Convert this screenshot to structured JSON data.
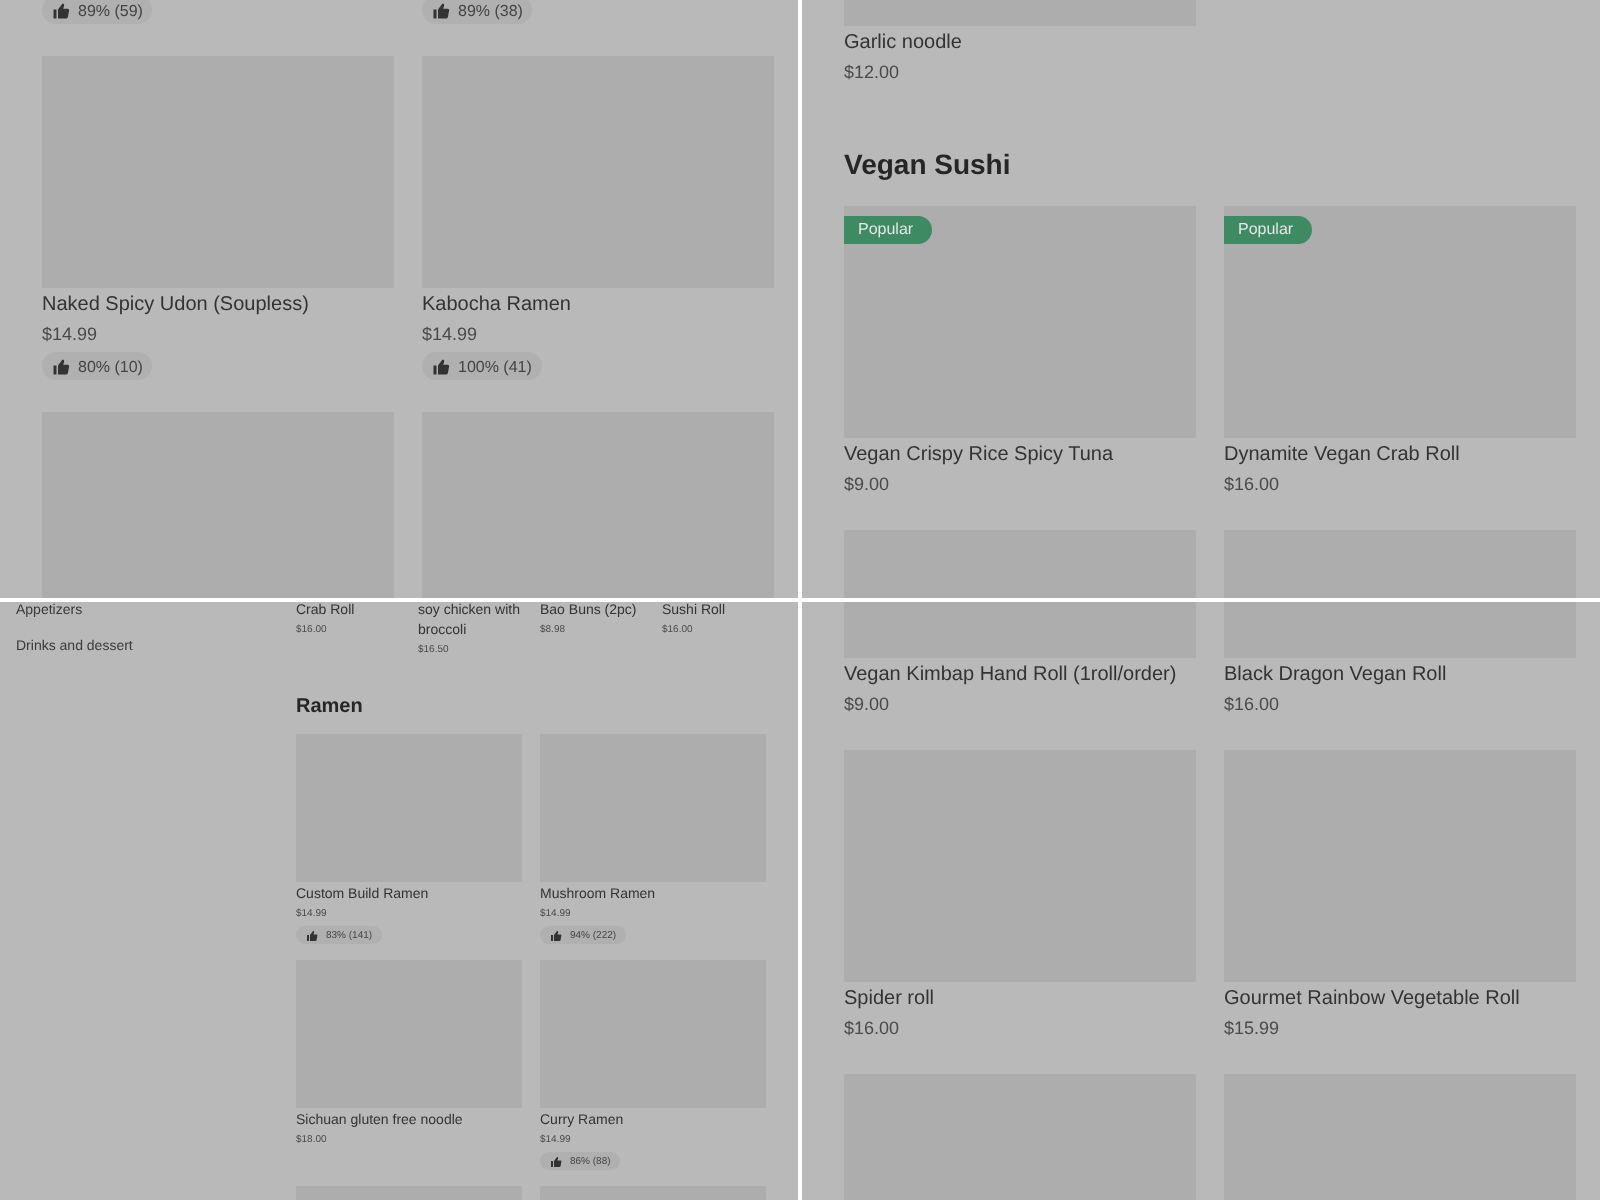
{
  "panels": [
    {
      "sections": [
        {
          "items": [
            {
              "kind": "rating",
              "rating": "89% (59)"
            },
            {
              "kind": "rating",
              "rating": "89% (38)"
            },
            {
              "kind": "full",
              "name": "Naked Spicy Udon (Soupless)",
              "price": "$14.99",
              "rating": "80% (10)"
            },
            {
              "kind": "full",
              "name": "Kabocha Ramen",
              "price": "$14.99",
              "rating": "100% (41)"
            },
            {
              "kind": "image"
            },
            {
              "kind": "image"
            }
          ]
        }
      ]
    },
    {
      "sections": [
        {
          "items": [
            {
              "kind": "full",
              "name": "Garlic noodle",
              "price": "$12.00"
            }
          ]
        },
        {
          "heading": "Vegan Sushi",
          "items": [
            {
              "kind": "full",
              "badge": "Popular",
              "name": "Vegan Crispy Rice Spicy Tuna",
              "price": "$9.00"
            },
            {
              "kind": "full",
              "badge": "Popular",
              "name": "Dynamite Vegan Crab Roll",
              "price": "$16.00"
            },
            {
              "kind": "image"
            },
            {
              "kind": "image"
            }
          ]
        }
      ]
    },
    {
      "sidebar": [
        "Appetizers",
        "Drinks and dessert"
      ],
      "sections": [
        {
          "items": [
            {
              "kind": "caption",
              "name": "Crab Roll",
              "price": "$16.00"
            },
            {
              "kind": "caption",
              "name": "soy chicken with broccoli",
              "price": "$16.50"
            },
            {
              "kind": "caption",
              "name": "Bao Buns (2pc)",
              "price": "$8.98"
            },
            {
              "kind": "caption",
              "name": "Sushi Roll",
              "price": "$16.00"
            }
          ]
        },
        {
          "heading": "Ramen",
          "items": [
            {
              "kind": "full",
              "name": "Custom Build Ramen",
              "price": "$14.99",
              "rating": "83% (141)"
            },
            {
              "kind": "full",
              "name": "Mushroom Ramen",
              "price": "$14.99",
              "rating": "94% (222)"
            },
            {
              "kind": "full",
              "name": "Sichuan gluten free noodle",
              "price": "$18.00"
            },
            {
              "kind": "full",
              "name": "Curry Ramen",
              "price": "$14.99",
              "rating": "86% (88)"
            },
            {
              "kind": "image"
            },
            {
              "kind": "image"
            }
          ]
        }
      ]
    },
    {
      "sections": [
        {
          "items": [
            {
              "kind": "full",
              "name": "Vegan Kimbap Hand Roll (1roll/order)",
              "price": "$9.00"
            },
            {
              "kind": "full",
              "name": "Black Dragon Vegan Roll",
              "price": "$16.00"
            },
            {
              "kind": "full",
              "name": "Spider roll",
              "price": "$16.00"
            },
            {
              "kind": "full",
              "name": "Gourmet Rainbow Vegetable Roll",
              "price": "$15.99"
            },
            {
              "kind": "image"
            },
            {
              "kind": "image"
            }
          ]
        }
      ]
    }
  ]
}
